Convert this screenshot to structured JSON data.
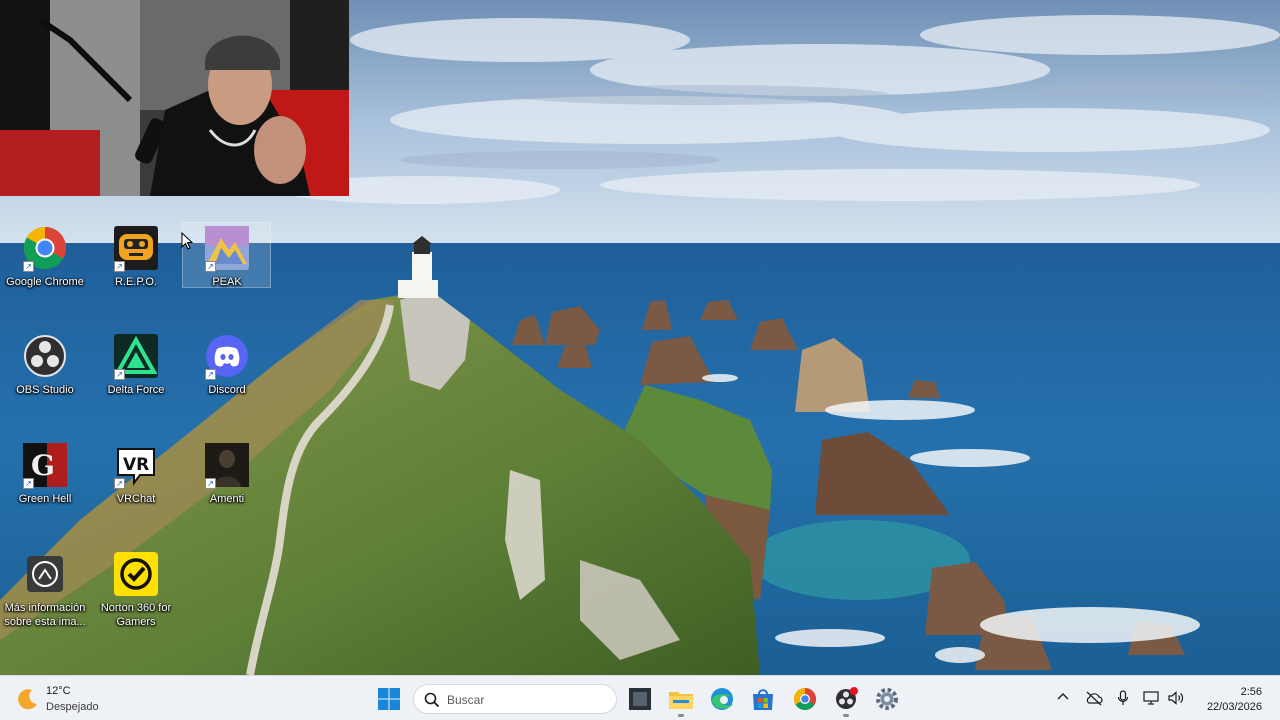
{
  "desktop": {
    "icons": [
      {
        "label": "Google Chrome",
        "icon": "chrome-icon"
      },
      {
        "label": "R.E.P.O.",
        "icon": "repo-game-icon"
      },
      {
        "label": "PEAK",
        "icon": "peak-game-icon"
      },
      {
        "label": "OBS Studio",
        "icon": "obs-icon"
      },
      {
        "label": "Delta Force",
        "icon": "delta-force-icon"
      },
      {
        "label": "Discord",
        "icon": "discord-icon"
      },
      {
        "label": "Green Hell",
        "icon": "green-hell-icon"
      },
      {
        "label": "VRChat",
        "icon": "vrchat-icon"
      },
      {
        "label": "Amenti",
        "icon": "amenti-icon"
      },
      {
        "label": "Más información sobre esta ima...",
        "icon": "spotlight-info-icon"
      },
      {
        "label": "Norton 360 for Gamers",
        "icon": "norton-icon"
      }
    ]
  },
  "taskbar": {
    "weather": {
      "temp": "12°C",
      "condition": "Despejado",
      "icon": "moon-weather-icon"
    },
    "start_icon": "windows-start-icon",
    "search_placeholder": "Buscar",
    "pinned": [
      "game-thumbnail-icon",
      "file-explorer-icon",
      "edge-icon",
      "store-icon",
      "chrome-icon",
      "obs-notification-icon",
      "settings-gear-icon"
    ],
    "tray": [
      "chevron-up-icon",
      "cloud-off-icon",
      "microphone-icon",
      "network-icon",
      "volume-icon"
    ],
    "clock": {
      "time": "2:56",
      "date": "22/03/2026"
    }
  },
  "colors": {
    "accent": "#0067c0",
    "taskbar_bg": "#eef1f6"
  }
}
